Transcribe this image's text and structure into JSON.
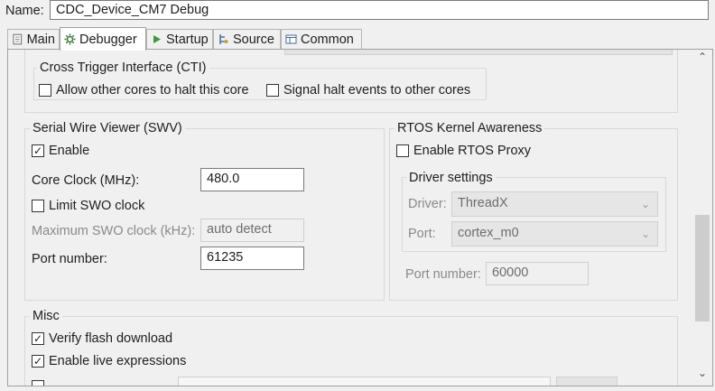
{
  "name": {
    "label": "Name:",
    "value": "CDC_Device_CM7 Debug"
  },
  "tabs": [
    {
      "label": "Main",
      "icon": "page-icon"
    },
    {
      "label": "Debugger",
      "icon": "debugger-gear-icon"
    },
    {
      "label": "Startup",
      "icon": "play-icon"
    },
    {
      "label": "Source",
      "icon": "source-icon"
    },
    {
      "label": "Common",
      "icon": "common-icon"
    }
  ],
  "cti": {
    "title": "Cross Trigger Interface (CTI)",
    "allow_halt": {
      "label": "Allow other cores to halt this core",
      "checked": false
    },
    "signal_halt": {
      "label": "Signal halt events to other cores",
      "checked": false
    }
  },
  "swv": {
    "title": "Serial Wire Viewer (SWV)",
    "enable": {
      "label": "Enable",
      "checked": true
    },
    "core_clock": {
      "label": "Core Clock (MHz):",
      "value": "480.0"
    },
    "limit_swo": {
      "label": "Limit SWO clock",
      "checked": false
    },
    "max_swo": {
      "label": "Maximum SWO clock (kHz):",
      "value": "auto detect"
    },
    "port": {
      "label": "Port number:",
      "value": "61235"
    }
  },
  "rtos": {
    "title": "RTOS Kernel Awareness",
    "enable_proxy": {
      "label": "Enable RTOS Proxy",
      "checked": false
    },
    "driver_settings": {
      "title": "Driver settings",
      "driver": {
        "label": "Driver:",
        "value": "ThreadX"
      },
      "port": {
        "label": "Port:",
        "value": "cortex_m0"
      }
    },
    "port_number": {
      "label": "Port number:",
      "value": "60000"
    }
  },
  "misc": {
    "title": "Misc",
    "verify_flash": {
      "label": "Verify flash download",
      "checked": true
    },
    "live_expr": {
      "label": "Enable live expressions",
      "checked": true
    }
  },
  "check_glyph": "✓",
  "scroll": {
    "up": "⌃",
    "down": "⌄"
  },
  "chevron": "⌄"
}
